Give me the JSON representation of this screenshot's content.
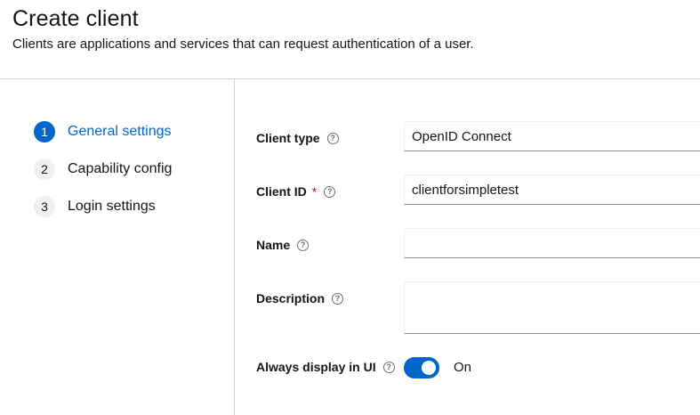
{
  "header": {
    "title": "Create client",
    "subtitle": "Clients are applications and services that can request authentication of a user."
  },
  "wizard": {
    "steps": [
      {
        "number": "1",
        "label": "General settings",
        "current": true
      },
      {
        "number": "2",
        "label": "Capability config",
        "current": false
      },
      {
        "number": "3",
        "label": "Login settings",
        "current": false
      }
    ]
  },
  "form": {
    "client_type": {
      "label": "Client type",
      "value": "OpenID Connect"
    },
    "client_id": {
      "label": "Client ID",
      "required_mark": "*",
      "value": "clientforsimpletest"
    },
    "name": {
      "label": "Name",
      "value": ""
    },
    "description": {
      "label": "Description",
      "value": ""
    },
    "always_display": {
      "label": "Always display in UI",
      "state_label": "On",
      "checked": true
    }
  },
  "icons": {
    "help": "help-circle-icon"
  },
  "colors": {
    "accent": "#0066cc",
    "required": "#c9190b",
    "border": "#d2d2d2"
  }
}
